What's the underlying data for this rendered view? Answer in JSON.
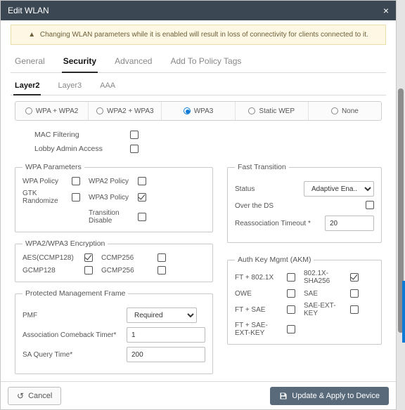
{
  "title": "Edit WLAN",
  "alert": "Changing WLAN parameters while it is enabled will result in loss of connectivity for clients connected to it.",
  "tabs": {
    "general": "General",
    "security": "Security",
    "advanced": "Advanced",
    "policytags": "Add To Policy Tags"
  },
  "subtabs": {
    "layer2": "Layer2",
    "layer3": "Layer3",
    "aaa": "AAA"
  },
  "radio": {
    "wpa_wpa2": "WPA + WPA2",
    "wpa2_wpa3": "WPA2 + WPA3",
    "wpa3": "WPA3",
    "static_wep": "Static WEP",
    "none": "None"
  },
  "rows": {
    "mac_filtering": "MAC Filtering",
    "lobby_admin": "Lobby Admin Access"
  },
  "wpa_params": {
    "legend": "WPA Parameters",
    "wpa_policy": "WPA Policy",
    "wpa2_policy": "WPA2 Policy",
    "gtk_randomize": "GTK Randomize",
    "wpa3_policy": "WPA3 Policy",
    "transition_disable": "Transition Disable"
  },
  "enc": {
    "legend": "WPA2/WPA3 Encryption",
    "aes": "AES(CCMP128)",
    "ccmp256": "CCMP256",
    "gcmp128": "GCMP128",
    "gcmp256": "GCMP256"
  },
  "pmf": {
    "legend": "Protected Management Frame",
    "pmf_label": "PMF",
    "pmf_value": "Required",
    "assoc_label": "Association Comeback Timer*",
    "assoc_value": "1",
    "sa_label": "SA Query Time*",
    "sa_value": "200"
  },
  "ft": {
    "legend": "Fast Transition",
    "status_label": "Status",
    "status_value": "Adaptive Ena...",
    "over_ds": "Over the DS",
    "reassoc_label": "Reassociation Timeout *",
    "reassoc_value": "20"
  },
  "akm": {
    "legend": "Auth Key Mgmt (AKM)",
    "ft8021x": "FT + 802.1X",
    "x8021x_sha256": "802.1X-SHA256",
    "owe": "OWE",
    "sae": "SAE",
    "ft_sae": "FT + SAE",
    "sae_ext": "SAE-EXT-KEY",
    "ft_sae_ext": "FT + SAE-EXT-KEY"
  },
  "footer": {
    "cancel": "Cancel",
    "apply": "Update & Apply to Device"
  }
}
